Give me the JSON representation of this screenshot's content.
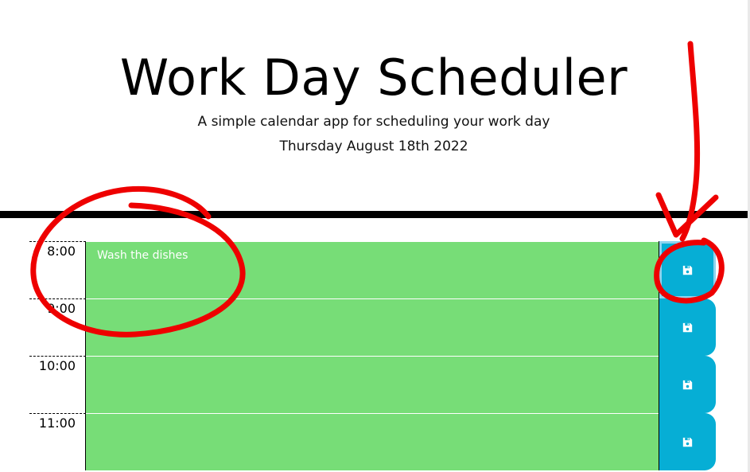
{
  "header": {
    "title": "Work Day Scheduler",
    "subtitle": "A simple calendar app for scheduling your work day",
    "current_day": "Thursday August 18th 2022"
  },
  "time_blocks": [
    {
      "hour": "8:00",
      "description": "Wash the dishes",
      "state": "future"
    },
    {
      "hour": "9:00",
      "description": "",
      "state": "future"
    },
    {
      "hour": "10:00",
      "description": "",
      "state": "future"
    },
    {
      "hour": "11:00",
      "description": "",
      "state": "future"
    }
  ],
  "save_icon": "floppy-disk-icon",
  "colors": {
    "future": "#77dd77",
    "save_button": "#06aed5",
    "annotation": "#ee0000"
  }
}
